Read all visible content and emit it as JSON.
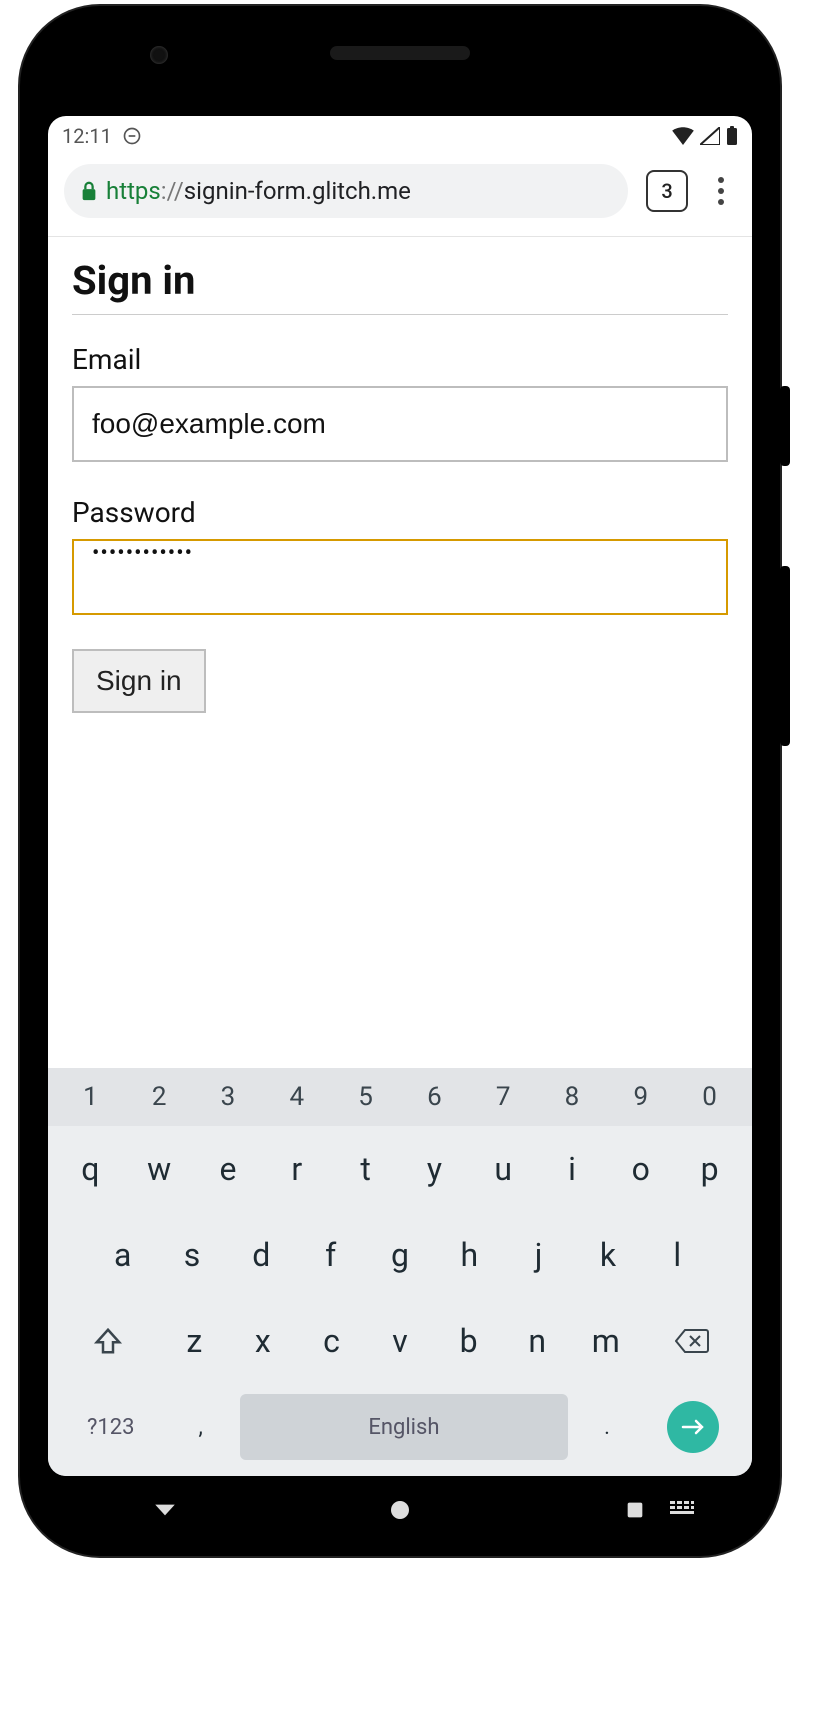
{
  "status": {
    "time": "12:11",
    "tab_count": "3"
  },
  "url": {
    "scheme": "https",
    "sep": "://",
    "host": "signin-form.glitch.me"
  },
  "page": {
    "title": "Sign in",
    "email_label": "Email",
    "email_value": "foo@example.com",
    "password_label": "Password",
    "password_value": "••••••••••••",
    "submit_label": "Sign in"
  },
  "keyboard": {
    "numbers": [
      "1",
      "2",
      "3",
      "4",
      "5",
      "6",
      "7",
      "8",
      "9",
      "0"
    ],
    "row1": [
      "q",
      "w",
      "e",
      "r",
      "t",
      "y",
      "u",
      "i",
      "o",
      "p"
    ],
    "row2": [
      "a",
      "s",
      "d",
      "f",
      "g",
      "h",
      "j",
      "k",
      "l"
    ],
    "row3": [
      "z",
      "x",
      "c",
      "v",
      "b",
      "n",
      "m"
    ],
    "symbols_key": "?123",
    "comma": ",",
    "space_label": "English",
    "period": "."
  }
}
